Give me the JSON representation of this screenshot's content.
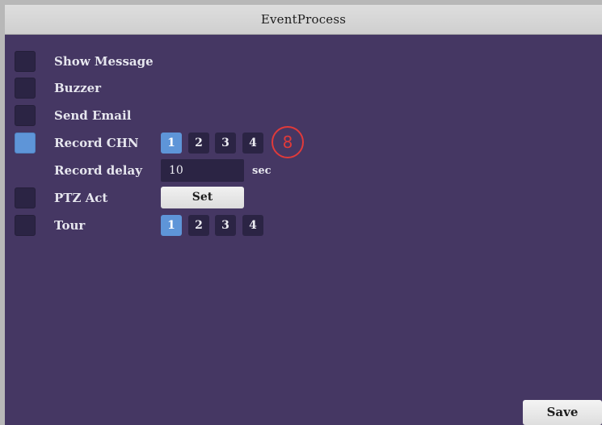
{
  "window": {
    "title": "EventProcess"
  },
  "options": {
    "show_message": {
      "label": "Show Message",
      "checked": false
    },
    "buzzer": {
      "label": "Buzzer",
      "checked": false
    },
    "send_email": {
      "label": "Send Email",
      "checked": false
    },
    "record_chn": {
      "label": "Record CHN",
      "checked": true,
      "channels": [
        "1",
        "2",
        "3",
        "4"
      ],
      "selected_channel": "1"
    },
    "record_delay": {
      "label": "Record delay",
      "value": "10",
      "unit": "sec"
    },
    "ptz_act": {
      "label": "PTZ Act",
      "checked": false,
      "button_label": "Set"
    },
    "tour": {
      "label": "Tour",
      "checked": false,
      "channels": [
        "1",
        "2",
        "3",
        "4"
      ],
      "selected_channel": "1"
    }
  },
  "annotation": {
    "marker": "8",
    "color": "#e03a3a"
  },
  "footer": {
    "save_label": "Save"
  },
  "colors": {
    "panel_bg": "#453763",
    "control_bg": "#2b2444",
    "accent": "#5e95d8"
  }
}
